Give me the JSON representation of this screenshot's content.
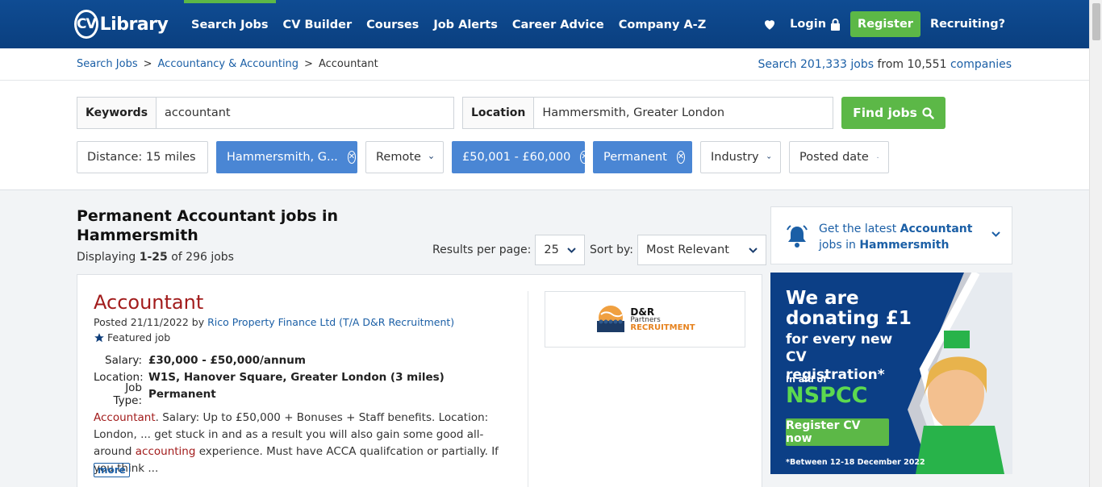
{
  "header": {
    "logo_text": "Library",
    "logo_cv": "CV",
    "nav": [
      "Search Jobs",
      "CV Builder",
      "Courses",
      "Job Alerts",
      "Career Advice",
      "Company A-Z"
    ],
    "login": "Login",
    "register": "Register",
    "recruiting": "Recruiting?"
  },
  "breadcrumb": {
    "items": [
      "Search Jobs",
      "Accountancy & Accounting"
    ],
    "current": "Accountant",
    "stats_prefix": "Search",
    "stats_jobs": "201,333 jobs",
    "stats_from": "from",
    "stats_companies_num": "10,551",
    "stats_companies": "companies"
  },
  "search": {
    "keywords_label": "Keywords",
    "keywords_value": "accountant",
    "location_label": "Location",
    "location_value": "Hammersmith, Greater London",
    "find_button": "Find jobs"
  },
  "filters": {
    "distance": "Distance: 15 miles",
    "location_chip": "Hammersmith, G...",
    "remote": "Remote",
    "salary_chip": "£50,001 - £60,000",
    "type_chip": "Permanent",
    "industry": "Industry",
    "posted": "Posted date"
  },
  "results": {
    "heading": "Permanent Accountant jobs in Hammersmith",
    "displaying_prefix": "Displaying",
    "displaying_range": "1-25",
    "displaying_suffix": "of 296 jobs",
    "per_page_label": "Results per page:",
    "per_page_value": "25",
    "sort_label": "Sort by:",
    "sort_value": "Most Relevant"
  },
  "job": {
    "title": "Accountant",
    "posted_prefix": "Posted 21/11/2022 by",
    "company": "Rico Property Finance Ltd (T/A D&R Recruitment)",
    "featured": "Featured job",
    "salary_label": "Salary:",
    "salary": "£30,000 - £50,000/annum",
    "location_label": "Location:",
    "location": "W1S, Hanover Square, Greater London (3 miles)",
    "type_label": "Job Type:",
    "type": "Permanent",
    "desc_hl1": "Accountant",
    "desc_1": ". Salary: Up to £50,000 + Bonuses + Staff benefits. Location: London, ... get stuck in and as a result you will also gain some good all-around",
    "desc_hl2": "accounting",
    "desc_2": " experience. Must have ACCA qualifcation or partially. If you think ...",
    "more": "more",
    "logo_a": "D&R",
    "logo_b": "Partners",
    "logo_c": "RECRUITMENT"
  },
  "alert": {
    "pre": "Get the latest",
    "bold1": "Accountant",
    "mid": "jobs in",
    "bold2": "Hammersmith"
  },
  "ad": {
    "line1": "We are",
    "line2": "donating £1",
    "line3": "for every new CV registration*",
    "line4": "In aid of",
    "line5": "NSPCC",
    "cta": "Register CV now",
    "footnote": "*Between 12-18 December 2022"
  },
  "colors": {
    "brand_blue": "#0f4c93",
    "green": "#5cb847",
    "chip_active": "#4a86d4",
    "title_red": "#a21c1c"
  }
}
